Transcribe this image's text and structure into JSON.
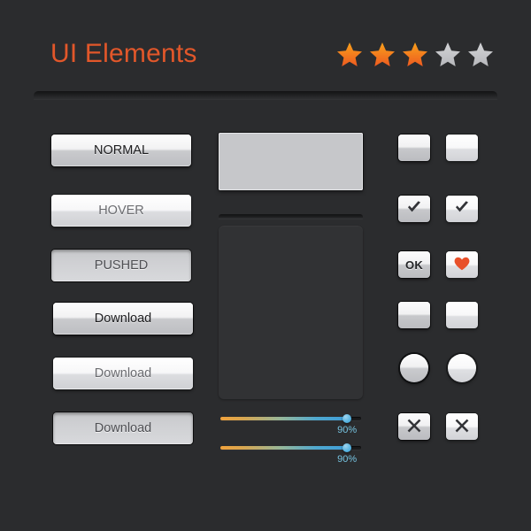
{
  "header": {
    "title": "UI Elements",
    "title_color": "#e2572a",
    "divider_name": "header-divider",
    "rating": {
      "name": "star-rating",
      "filled": 3,
      "total": 5,
      "filled_color": "#f07a1e",
      "empty_color": "#c4c5c8",
      "stars": [
        {
          "state": "filled"
        },
        {
          "state": "filled"
        },
        {
          "state": "filled"
        },
        {
          "state": "empty"
        },
        {
          "state": "empty"
        }
      ]
    }
  },
  "buttons": {
    "state_buttons": [
      {
        "label": "NORMAL",
        "state": "normal"
      },
      {
        "label": "HOVER",
        "state": "hover"
      },
      {
        "label": "PUSHED",
        "state": "pushed"
      }
    ],
    "download_buttons": [
      {
        "label": "Download",
        "state": "normal"
      },
      {
        "label": "Download",
        "state": "hover"
      },
      {
        "label": "Download",
        "state": "pushed"
      }
    ]
  },
  "panels": {
    "light_panel": {
      "name": "light-panel",
      "fill": "#c6c7ca"
    },
    "divider": {
      "name": "panel-divider"
    },
    "dark_panel": {
      "name": "dark-panel",
      "fill": "#313234"
    }
  },
  "sliders": [
    {
      "value": "90%",
      "percent": 90,
      "track_color": "#1b1c1d",
      "label_color": "#76c3e0"
    },
    {
      "value": "90%",
      "percent": 90,
      "track_color": "#1b1c1d",
      "label_color": "#76c3e0"
    }
  ],
  "controls": {
    "rows": [
      {
        "name": "empty-square-buttons",
        "normal": {
          "icon": "blank",
          "label": ""
        },
        "hover": {
          "icon": "blank",
          "label": ""
        }
      },
      {
        "name": "checkbox-buttons",
        "normal": {
          "icon": "check",
          "label": ""
        },
        "hover": {
          "icon": "check",
          "label": ""
        }
      },
      {
        "name": "ok-and-heart-buttons",
        "normal": {
          "icon": "text",
          "label": "OK"
        },
        "hover": {
          "icon": "heart",
          "label": ""
        }
      },
      {
        "name": "empty-square-buttons-2",
        "normal": {
          "icon": "blank",
          "label": ""
        },
        "hover": {
          "icon": "blank",
          "label": ""
        }
      },
      {
        "name": "round-buttons",
        "normal": {
          "icon": "blank",
          "label": ""
        },
        "hover": {
          "icon": "blank",
          "label": ""
        }
      },
      {
        "name": "close-buttons",
        "normal": {
          "icon": "cross",
          "label": ""
        },
        "hover": {
          "icon": "cross",
          "label": ""
        }
      }
    ],
    "heart_color": "#e8502a",
    "glyph_color": "#333438"
  }
}
